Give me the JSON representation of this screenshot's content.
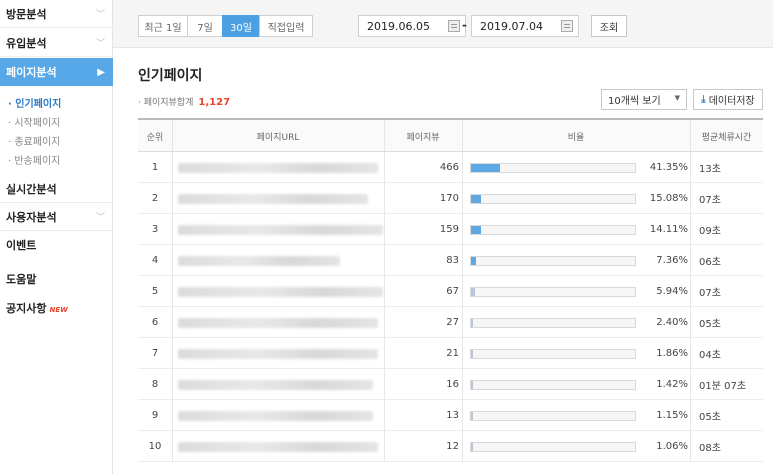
{
  "sidebar": {
    "items": [
      {
        "label": "방문분석"
      },
      {
        "label": "유입분석"
      },
      {
        "label": "페이지분석"
      }
    ],
    "sub_items": [
      "· 인기페이지",
      "· 시작페이지",
      "· 종료페이지",
      "· 반송페이지"
    ],
    "more_items": [
      {
        "label": "실시간분석"
      },
      {
        "label": "사용자분석"
      },
      {
        "label": "이벤트"
      },
      {
        "label": "도움말"
      },
      {
        "label": "공지사항"
      }
    ],
    "new_badge": "NEW"
  },
  "toolbar": {
    "ranges": [
      "최근 1일",
      "7일",
      "30일",
      "직접입력"
    ],
    "active_range": "30일",
    "start_date": "2019.06.05",
    "end_date": "2019.07.04",
    "search_label": "조회"
  },
  "page": {
    "title": "인기페이지",
    "total_label": "· 페이지뷰합계",
    "total_value": "1,127",
    "page_size": "10개씩 보기",
    "save_label": "데이터저장"
  },
  "table": {
    "headers": [
      "순위",
      "페이지URL",
      "페이지뷰",
      "비율",
      "평균체류시간"
    ],
    "rows": [
      {
        "rank": "1",
        "views": "466",
        "ratio": 41.35,
        "ratio_label": "41.35%",
        "time": "13초"
      },
      {
        "rank": "2",
        "views": "170",
        "ratio": 15.08,
        "ratio_label": "15.08%",
        "time": "07초"
      },
      {
        "rank": "3",
        "views": "159",
        "ratio": 14.11,
        "ratio_label": "14.11%",
        "time": "09초"
      },
      {
        "rank": "4",
        "views": "83",
        "ratio": 7.36,
        "ratio_label": "7.36%",
        "time": "06초"
      },
      {
        "rank": "5",
        "views": "67",
        "ratio": 5.94,
        "ratio_label": "5.94%",
        "time": "07초"
      },
      {
        "rank": "6",
        "views": "27",
        "ratio": 2.4,
        "ratio_label": "2.40%",
        "time": "05초"
      },
      {
        "rank": "7",
        "views": "21",
        "ratio": 1.86,
        "ratio_label": "1.86%",
        "time": "04초"
      },
      {
        "rank": "8",
        "views": "16",
        "ratio": 1.42,
        "ratio_label": "1.42%",
        "time": "01분 07초"
      },
      {
        "rank": "9",
        "views": "13",
        "ratio": 1.15,
        "ratio_label": "1.15%",
        "time": "05초"
      },
      {
        "rank": "10",
        "views": "12",
        "ratio": 1.06,
        "ratio_label": "1.06%",
        "time": "08초"
      }
    ]
  },
  "colors": {
    "accent": "#57a8e8",
    "bar": "#5ea8e4",
    "bar_light": "#b7c6d8",
    "highlight": "#e8452c"
  }
}
